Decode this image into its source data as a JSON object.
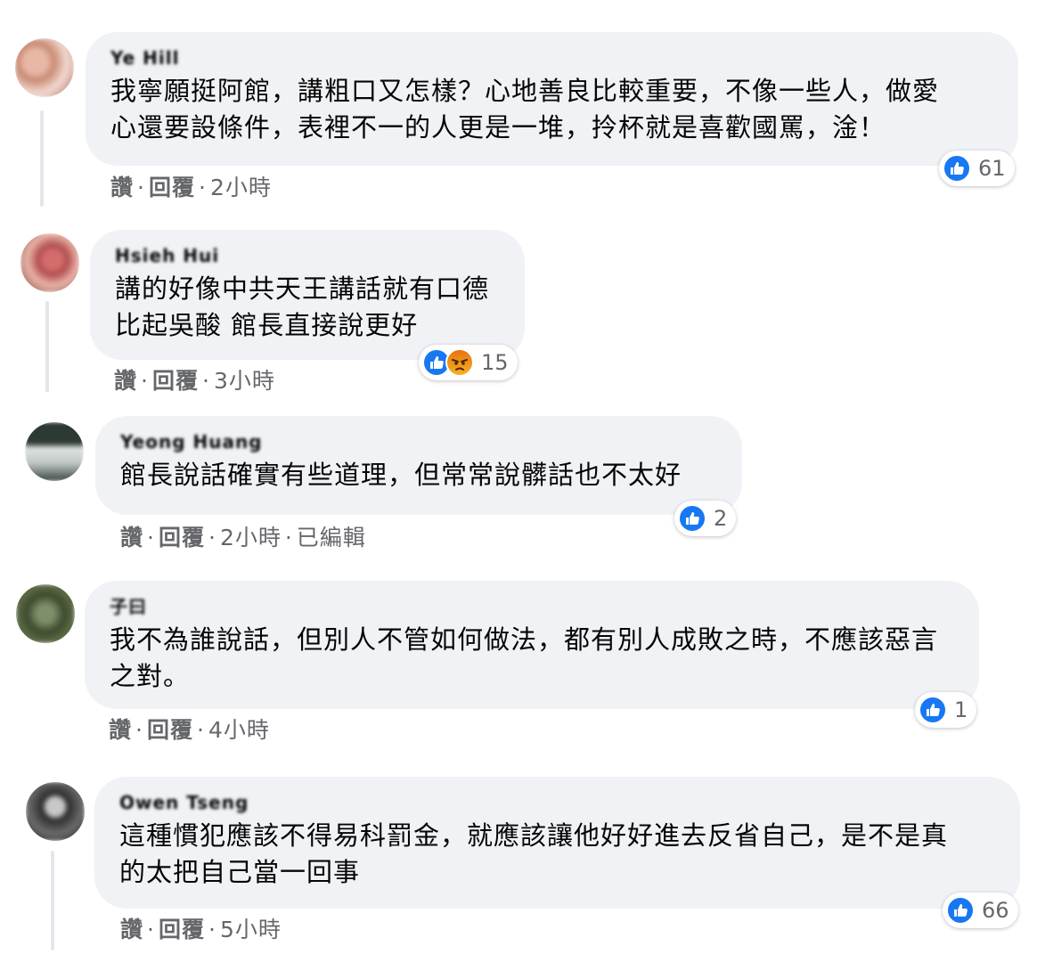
{
  "labels": {
    "like": "讚",
    "reply": "回覆",
    "dot": "·"
  },
  "colors": {
    "bubble": "#f0f2f5",
    "like_blue": "#1877f2",
    "meta_gray": "#65676b"
  },
  "comments": [
    {
      "author": "Ye Hill",
      "lines": [
        "我寧願挺阿館，講粗口又怎樣？心地善良比較重要，不像一些人，做愛",
        "心還要設條件，表裡不一的人更是一堆，拎杯就是喜歡國罵，淦！"
      ],
      "time": "2小時",
      "edited": "",
      "reactions": [
        "like-icon"
      ],
      "count": "61"
    },
    {
      "author": "Hsieh Hui",
      "lines": [
        "講的好像中共天王講話就有口德",
        "比起吳酸 館長直接說更好"
      ],
      "time": "3小時",
      "edited": "",
      "reactions": [
        "like-icon",
        "angry-icon"
      ],
      "count": "15"
    },
    {
      "author": "Yeong Huang",
      "lines": [
        "館長說話確實有些道理，但常常說髒話也不太好"
      ],
      "time": "2小時",
      "edited": "已編輯",
      "reactions": [
        "like-icon"
      ],
      "count": "2"
    },
    {
      "author": "子曰",
      "lines": [
        "我不為誰說話，但別人不管如何做法，都有別人成敗之時，不應該惡言",
        "之對。"
      ],
      "time": "4小時",
      "edited": "",
      "reactions": [
        "like-icon"
      ],
      "count": "1"
    },
    {
      "author": "Owen Tseng",
      "lines": [
        "這種慣犯應該不得易科罰金，就應該讓他好好進去反省自己，是不是真",
        "的太把自己當一回事"
      ],
      "time": "5小時",
      "edited": "",
      "reactions": [
        "like-icon"
      ],
      "count": "66"
    }
  ]
}
